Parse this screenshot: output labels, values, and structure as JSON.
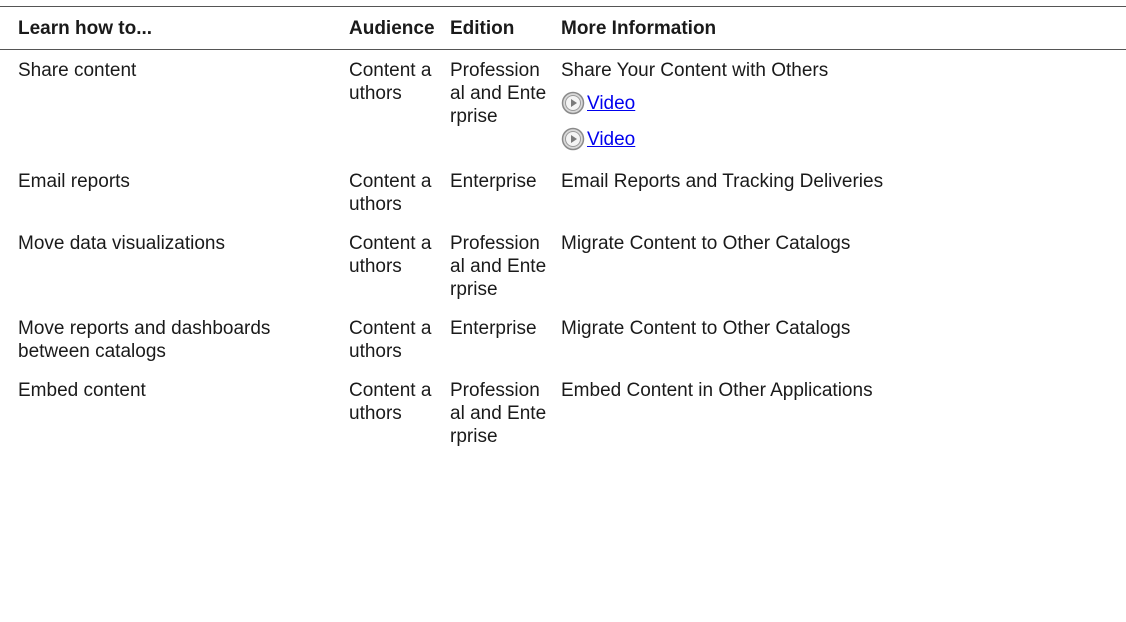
{
  "table": {
    "headers": [
      "Learn how to...",
      "Audience",
      "Edition",
      "More Information"
    ],
    "rows": [
      {
        "learn": "Share content",
        "audience": "Content authors",
        "edition": "Professional and Enterprise",
        "info": "Share Your Content with Others",
        "videos": [
          {
            "label": "Video",
            "icon": "play-circle-icon"
          },
          {
            "label": "Video",
            "icon": "play-circle-icon"
          }
        ]
      },
      {
        "learn": "Email reports",
        "audience": "Content authors",
        "edition": "Enterprise",
        "info": "Email Reports and Tracking Deliveries"
      },
      {
        "learn": "Move data visualizations",
        "audience": "Content authors",
        "edition": "Professional and Enterprise",
        "info": "Migrate Content to Other Catalogs"
      },
      {
        "learn": "Move reports and dashboards between catalogs",
        "audience": "Content authors",
        "edition": "Enterprise",
        "info": "Migrate Content to Other Catalogs"
      },
      {
        "learn": "Embed content",
        "audience": "Content authors",
        "edition": "Professional and Enterprise",
        "info": "Embed Content in Other Applications"
      }
    ]
  },
  "colors": {
    "link": "#0000ee",
    "rule": "#555555",
    "icon_fill": "#d9d9d9",
    "icon_stroke": "#8a8a8a"
  }
}
